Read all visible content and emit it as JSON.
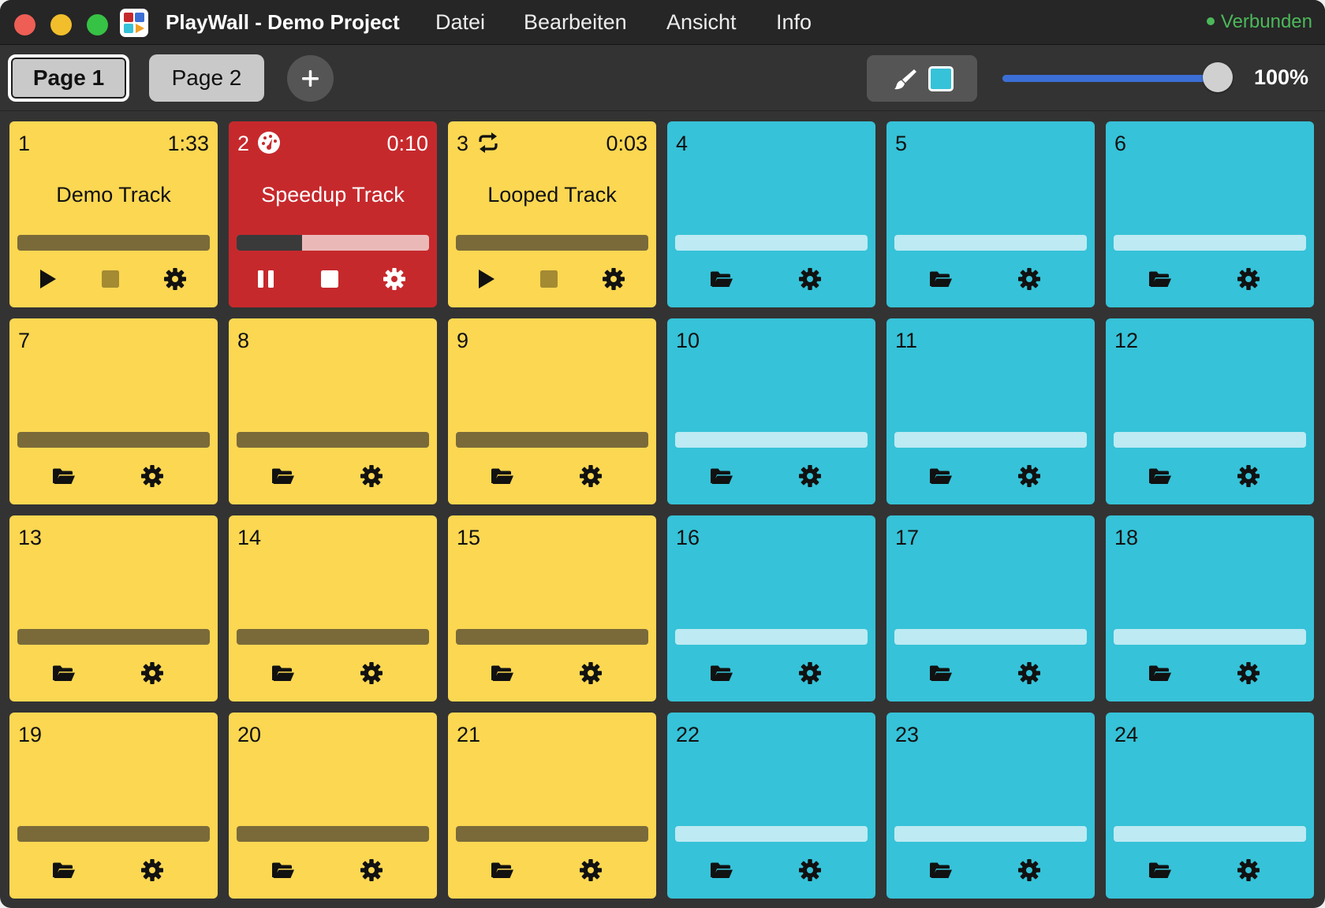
{
  "window": {
    "title": "PlayWall - Demo Project",
    "status": "Verbunden"
  },
  "menu": [
    "Datei",
    "Bearbeiten",
    "Ansicht",
    "Info"
  ],
  "toolbar": {
    "pages": [
      {
        "label": "Page 1",
        "active": true
      },
      {
        "label": "Page 2",
        "active": false
      }
    ],
    "color_swatch": "#36c2d8",
    "zoom_percent": 100,
    "zoom_label": "100%"
  },
  "pads": [
    {
      "num": "1",
      "name": "Demo Track",
      "time": "1:33",
      "color": "yellow",
      "state": "loaded",
      "progress": 0
    },
    {
      "num": "2",
      "name": "Speedup Track",
      "time": "0:10",
      "color": "red",
      "state": "playing",
      "badge": "speedometer-icon",
      "progress": 0.34
    },
    {
      "num": "3",
      "name": "Looped Track",
      "time": "0:03",
      "color": "yellow",
      "state": "loaded",
      "badge": "loop-icon",
      "progress": 0
    },
    {
      "num": "4",
      "color": "cyan",
      "state": "empty"
    },
    {
      "num": "5",
      "color": "cyan",
      "state": "empty"
    },
    {
      "num": "6",
      "color": "cyan",
      "state": "empty"
    },
    {
      "num": "7",
      "color": "yellow",
      "state": "empty"
    },
    {
      "num": "8",
      "color": "yellow",
      "state": "empty"
    },
    {
      "num": "9",
      "color": "yellow",
      "state": "empty"
    },
    {
      "num": "10",
      "color": "cyan",
      "state": "empty"
    },
    {
      "num": "11",
      "color": "cyan",
      "state": "empty"
    },
    {
      "num": "12",
      "color": "cyan",
      "state": "empty"
    },
    {
      "num": "13",
      "color": "yellow",
      "state": "empty"
    },
    {
      "num": "14",
      "color": "yellow",
      "state": "empty"
    },
    {
      "num": "15",
      "color": "yellow",
      "state": "empty"
    },
    {
      "num": "16",
      "color": "cyan",
      "state": "empty"
    },
    {
      "num": "17",
      "color": "cyan",
      "state": "empty"
    },
    {
      "num": "18",
      "color": "cyan",
      "state": "empty"
    },
    {
      "num": "19",
      "color": "yellow",
      "state": "empty"
    },
    {
      "num": "20",
      "color": "yellow",
      "state": "empty"
    },
    {
      "num": "21",
      "color": "yellow",
      "state": "empty"
    },
    {
      "num": "22",
      "color": "cyan",
      "state": "empty"
    },
    {
      "num": "23",
      "color": "cyan",
      "state": "empty"
    },
    {
      "num": "24",
      "color": "cyan",
      "state": "empty"
    }
  ]
}
